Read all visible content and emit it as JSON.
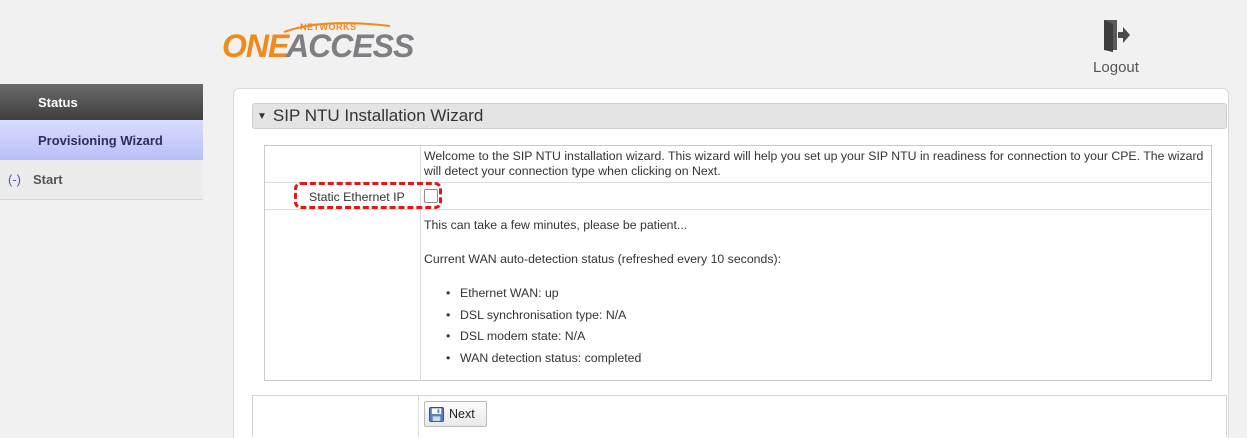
{
  "header": {
    "logo": {
      "one": "ONE",
      "access": "ACCESS",
      "networks": "NETWORKS"
    },
    "logout_label": "Logout"
  },
  "sidebar": {
    "items": [
      {
        "label": "Status"
      },
      {
        "label": "Provisioning Wizard"
      },
      {
        "label": "Start",
        "prefix": "(-)"
      }
    ]
  },
  "wizard": {
    "title": "SIP NTU Installation Wizard",
    "welcome_text": "Welcome to the SIP NTU installation wizard. This wizard will help you set up your SIP NTU in readiness for connection to your CPE. The wizard will detect your connection type when clicking on Next.",
    "static_ip_label": "Static Ethernet IP",
    "static_ip_checked": false,
    "patience_text": "This can take a few minutes, please be patient...",
    "status_heading": "Current WAN auto-detection status (refreshed every 10 seconds):",
    "status_items": [
      "Ethernet WAN: up",
      "DSL synchronisation type: N/A",
      "DSL modem state: N/A",
      "WAN detection status: completed"
    ],
    "next_label": "Next"
  },
  "colors": {
    "accent_orange": "#f08a1a",
    "highlight_red": "#e01818",
    "sidebar_active": "#b9c0f5"
  }
}
